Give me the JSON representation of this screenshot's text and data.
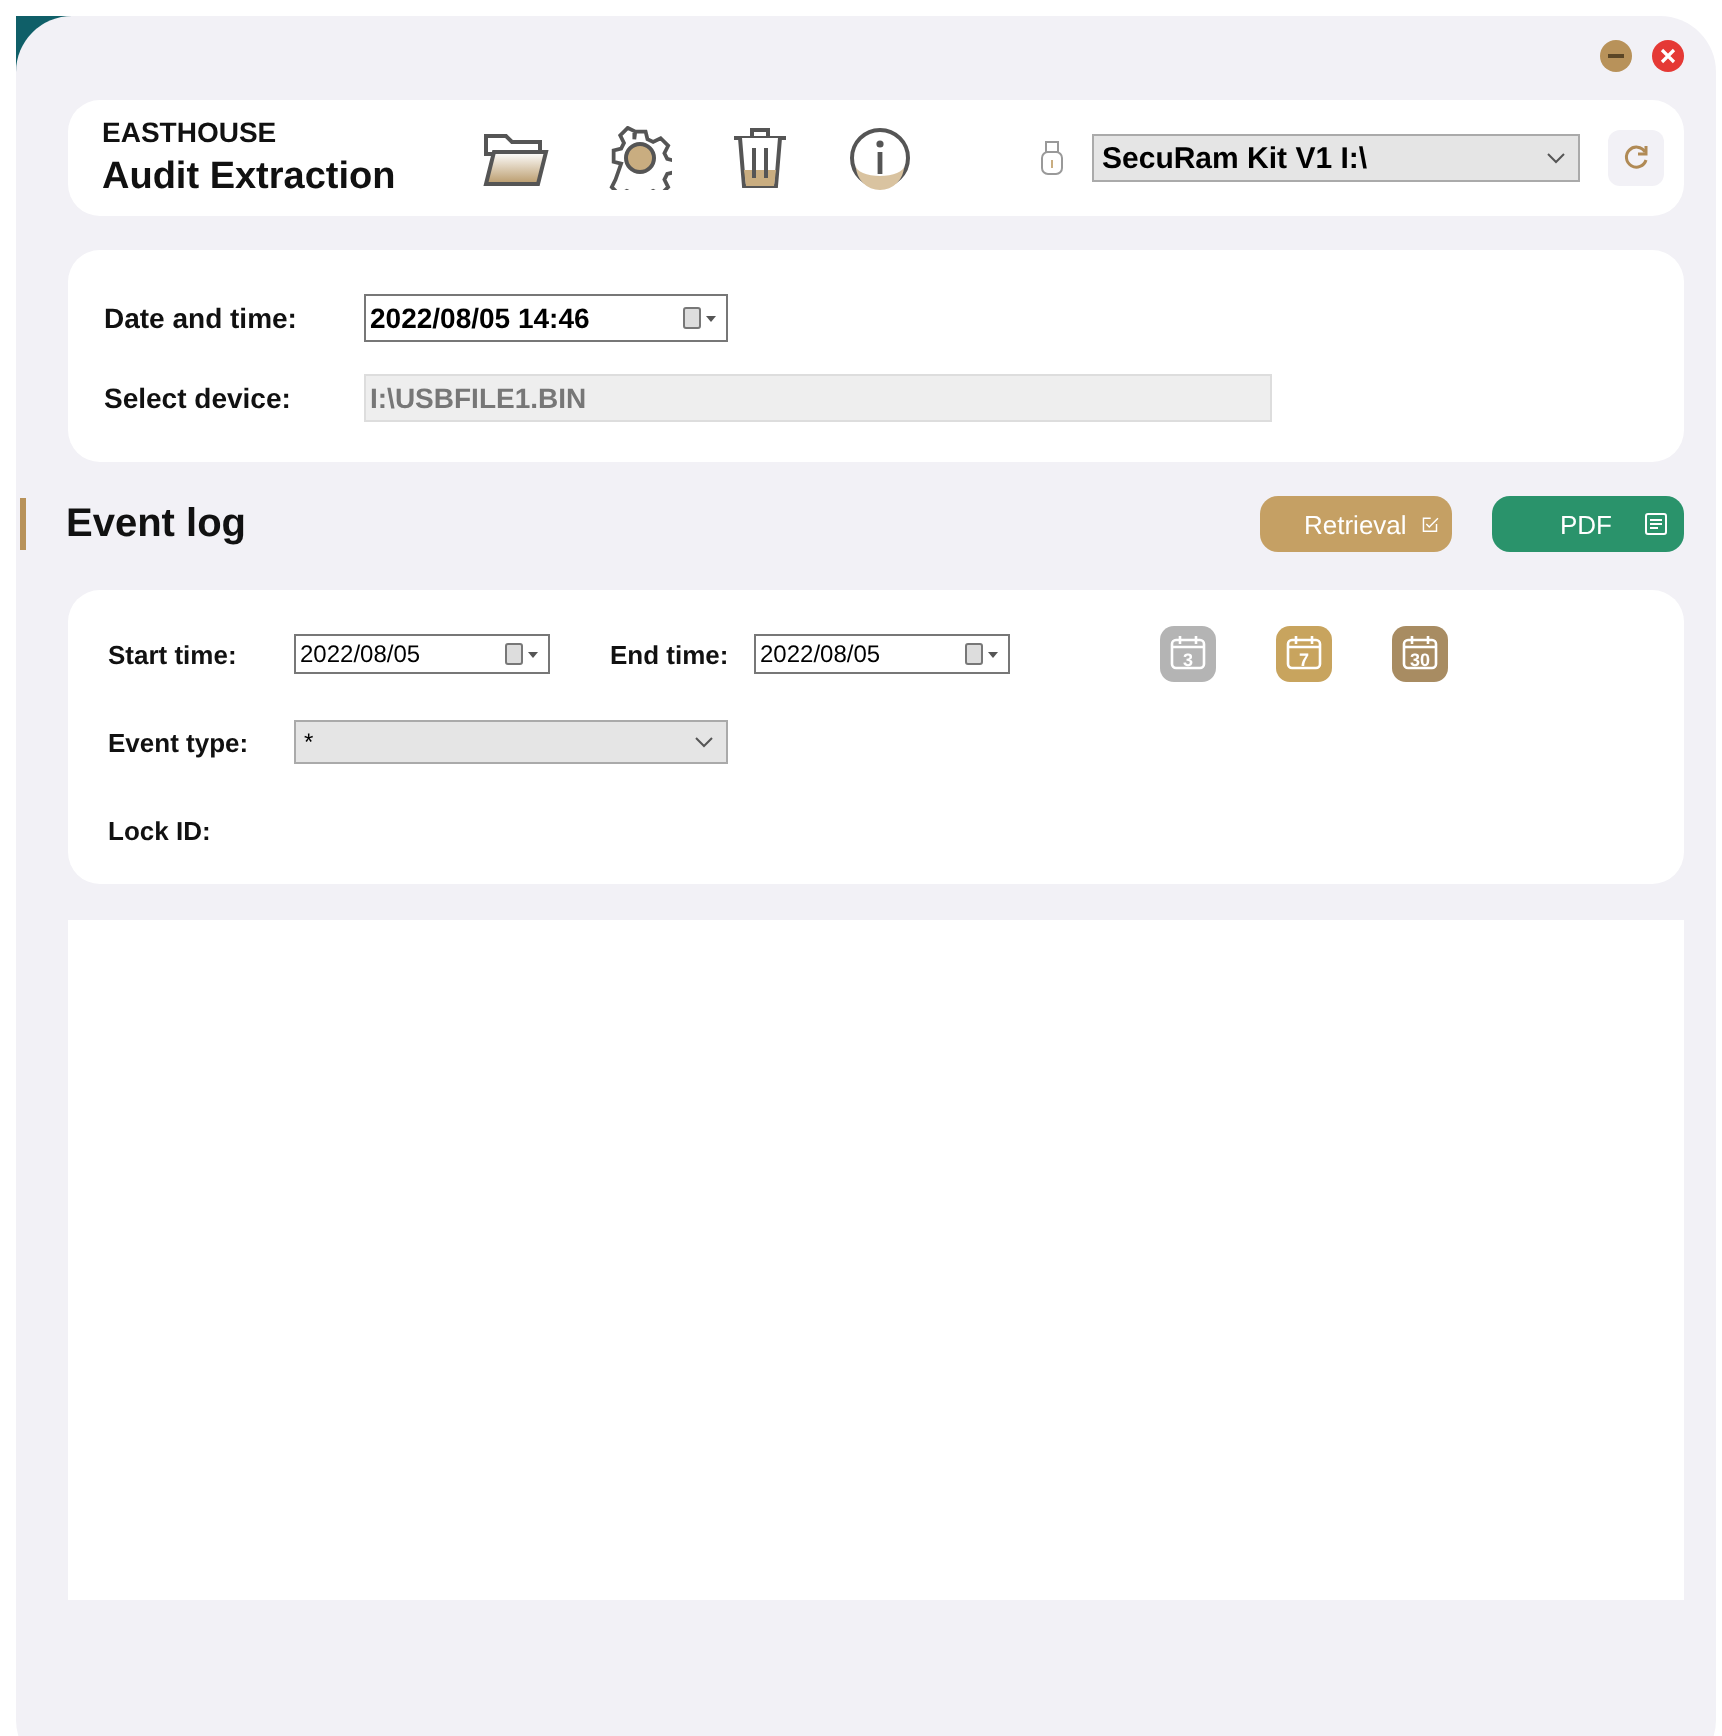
{
  "app": {
    "brand": "EASTHOUSE",
    "title": "Audit Extraction"
  },
  "toolbar": {
    "device_select": {
      "value": "SecuRam Kit V1 I:\\"
    }
  },
  "device_info": {
    "date_time": {
      "label": "Date and time:",
      "value": "2022/08/05 14:46"
    },
    "select_device": {
      "label": "Select device:",
      "value": "I:\\USBFILE1.BIN",
      "disabled": true
    }
  },
  "event_log": {
    "title": "Event log",
    "buttons": [
      {
        "kind": "retrieval",
        "label": "Retrieval"
      },
      {
        "kind": "pdf",
        "label": "PDF"
      }
    ],
    "filters": {
      "start_time": {
        "label": "Start time:",
        "value": "2022/08/05"
      },
      "end_time": {
        "label": "End time:",
        "value": "2022/08/05"
      },
      "event_type": {
        "label": "Event type:",
        "value": "*"
      },
      "lock_id": {
        "label": "Lock ID:"
      }
    },
    "quick_ranges": [
      {
        "label": "3",
        "color": "#b4b4b4"
      },
      {
        "label": "7",
        "color": "#c8a45e"
      },
      {
        "label": "30",
        "color": "#a88c62"
      }
    ]
  }
}
